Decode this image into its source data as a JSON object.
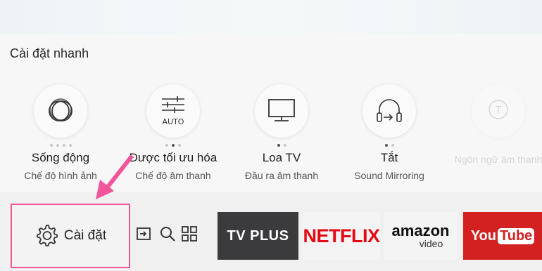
{
  "panel": {
    "title": "Cài đặt nhanh"
  },
  "quick_settings": [
    {
      "icon": "picture-mode-icon",
      "value": "Sống động",
      "label": "Chế độ hình ảnh"
    },
    {
      "icon": "equalizer-auto-icon",
      "badge": "AUTO",
      "value": "Được tối ưu hóa",
      "label": "Chế độ âm thanh"
    },
    {
      "icon": "tv-speaker-icon",
      "value": "Loa TV",
      "label": "Đầu ra âm thanh"
    },
    {
      "icon": "headphone-mirroring-icon",
      "value": "Tắt",
      "label": "Sound Mirroring"
    },
    {
      "icon": "language-icon",
      "value": "",
      "label": "Ngôn ngữ âm thanh"
    }
  ],
  "bottom_bar": {
    "settings_label": "Cài đặt",
    "tools": [
      "source-icon",
      "search-icon",
      "apps-grid-icon"
    ],
    "apps": [
      {
        "name": "TV PLUS",
        "text": "TV PLUS"
      },
      {
        "name": "NETFLIX",
        "text": "NETFLIX"
      },
      {
        "name": "amazon video",
        "text": "amazon",
        "sub": "video"
      },
      {
        "name": "YouTube",
        "you": "You",
        "tube": "Tube"
      }
    ]
  },
  "colors": {
    "highlight": "#f2559a",
    "netflix": "#e50914",
    "youtube": "#d32020"
  }
}
